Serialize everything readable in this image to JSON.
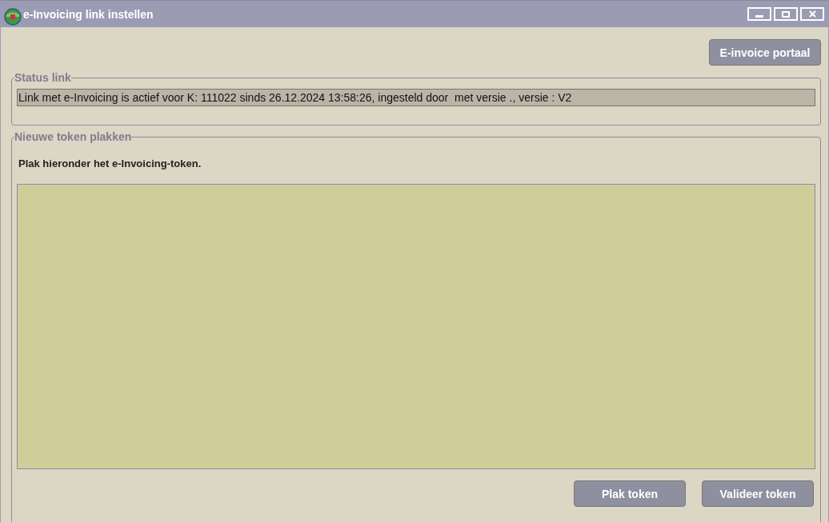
{
  "window": {
    "title": "e-Invoicing link instellen"
  },
  "portal_button": "E-invoice portaal",
  "status_group": {
    "legend": "Status link",
    "status_text": "Link met e-Invoicing is actief voor K: 111022 sinds 26.12.2024 13:58:26, ingesteld door  met versie ., versie : V2"
  },
  "token_group": {
    "legend": "Nieuwe token plakken",
    "instruction": "Plak hieronder het e-Invoicing-token.",
    "buttons": [
      "Plak token",
      "Valideer token"
    ]
  }
}
